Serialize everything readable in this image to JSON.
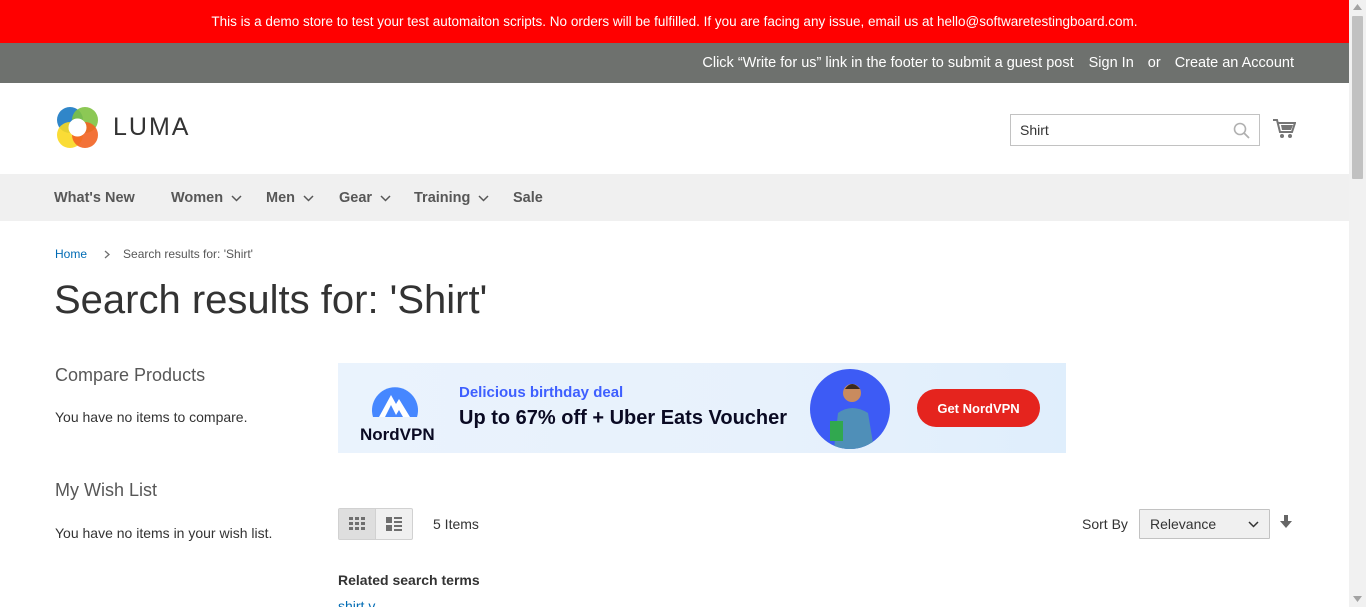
{
  "demo_notice": "This is a demo store to test your test automaiton scripts. No orders will be fulfilled. If you are facing any issue, email us at hello@softwaretestingboard.com.",
  "header_panel": {
    "guest_post": "Click “Write for us” link in the footer to submit a guest post",
    "sign_in": "Sign In",
    "or": "or",
    "create_account": "Create an Account"
  },
  "logo": {
    "text": "LUMA"
  },
  "search": {
    "value": "Shirt",
    "icon": "search-icon"
  },
  "cart": {
    "icon": "cart-icon"
  },
  "nav": {
    "items": [
      {
        "label": "What's New",
        "has_dropdown": false
      },
      {
        "label": "Women",
        "has_dropdown": true
      },
      {
        "label": "Men",
        "has_dropdown": true
      },
      {
        "label": "Gear",
        "has_dropdown": true
      },
      {
        "label": "Training",
        "has_dropdown": true
      },
      {
        "label": "Sale",
        "has_dropdown": false
      }
    ]
  },
  "breadcrumb": {
    "home": "Home",
    "current": "Search results for: 'Shirt'"
  },
  "page_title": "Search results for: 'Shirt'",
  "sidebar": {
    "compare_title": "Compare Products",
    "compare_text": "You have no items to compare.",
    "wishlist_title": "My Wish List",
    "wishlist_text": "You have no items in your wish list."
  },
  "ad": {
    "brand": "NordVPN",
    "subheading": "Delicious birthday deal",
    "headline": "Up to 67% off + Uber Eats Voucher",
    "cta": "Get NordVPN"
  },
  "toolbar": {
    "modes": [
      "grid-icon",
      "list-icon"
    ],
    "items_count": "5 Items",
    "sort_label": "Sort By",
    "sort_value": "Relevance",
    "sort_direction_icon": "arrow-down-icon"
  },
  "related": {
    "title": "Related search terms",
    "first_term": "shirt v"
  },
  "colors": {
    "demo_banner": "#ff0000",
    "header_panel": "#6e716e",
    "nav_background": "#f0f0f0",
    "link": "#006bb4",
    "ad_cta": "#e5241e",
    "ad_accent": "#3e5fff"
  }
}
